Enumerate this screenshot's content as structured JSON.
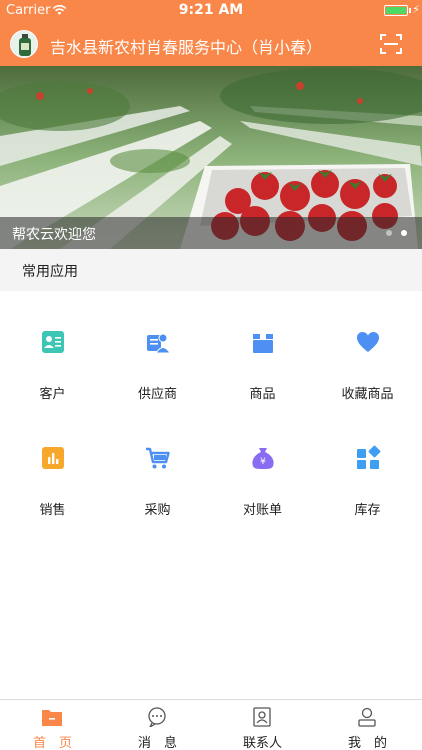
{
  "status_bar": {
    "carrier": "Carrier",
    "time": "9:21 AM"
  },
  "nav": {
    "title": "吉水县新农村肖春服务中心（肖小春）"
  },
  "banner": {
    "caption": "帮农云欢迎您"
  },
  "section": {
    "title": "常用应用"
  },
  "apps": [
    {
      "label": "客户",
      "icon": "customer-icon",
      "color": "#3ec6b4"
    },
    {
      "label": "供应商",
      "icon": "supplier-icon",
      "color": "#4d8ff2"
    },
    {
      "label": "商品",
      "icon": "goods-icon",
      "color": "#4d8ff2"
    },
    {
      "label": "收藏商品",
      "icon": "heart-icon",
      "color": "#4d8ff2"
    },
    {
      "label": "销售",
      "icon": "sales-icon",
      "color": "#f7a72c"
    },
    {
      "label": "采购",
      "icon": "cart-icon",
      "color": "#4d8ff2"
    },
    {
      "label": "对账单",
      "icon": "money-bag-icon",
      "color": "#8a6cf2"
    },
    {
      "label": "库存",
      "icon": "inventory-icon",
      "color": "#3d9ef2"
    }
  ],
  "tabs": [
    {
      "label": "首　页",
      "icon": "home-folder-icon",
      "active": true
    },
    {
      "label": "消　息",
      "icon": "message-icon",
      "active": false
    },
    {
      "label": "联系人",
      "icon": "contacts-icon",
      "active": false
    },
    {
      "label": "我　的",
      "icon": "profile-icon",
      "active": false
    }
  ],
  "colors": {
    "accent": "#f9874a",
    "section_bg": "#f4f4f4"
  }
}
